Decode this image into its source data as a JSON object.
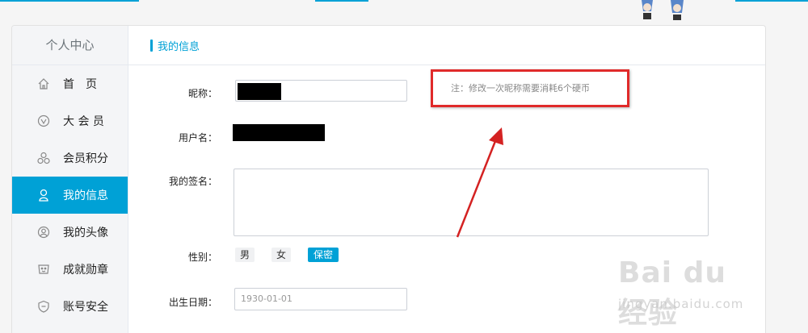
{
  "colors": {
    "accent": "#00a1d6",
    "annotation": "#e02a2a",
    "sidebar_bg": "#f4f5f7"
  },
  "sidebar": {
    "title": "个人中心",
    "items": [
      {
        "label": "首　页",
        "icon": "home-icon",
        "active": false
      },
      {
        "label": "大 会 员",
        "icon": "vip-icon",
        "active": false
      },
      {
        "label": "会员积分",
        "icon": "points-icon",
        "active": false
      },
      {
        "label": "我的信息",
        "icon": "user-icon",
        "active": true
      },
      {
        "label": "我的头像",
        "icon": "avatar-icon",
        "active": false
      },
      {
        "label": "成就勋章",
        "icon": "medal-icon",
        "active": false
      },
      {
        "label": "账号安全",
        "icon": "shield-icon",
        "active": false
      }
    ]
  },
  "content": {
    "title": "我的信息",
    "nickname_label": "昵称：",
    "nickname_hint": "注：修改一次昵称需要消耗6个硬币",
    "username_label": "用户名：",
    "signature_label": "我的签名：",
    "signature_value": "",
    "gender_label": "性别：",
    "gender_options": [
      {
        "label": "男",
        "selected": false
      },
      {
        "label": "女",
        "selected": false
      },
      {
        "label": "保密",
        "selected": true
      }
    ],
    "birthday_label": "出生日期：",
    "birthday_value": "1930-01-01"
  },
  "watermark": {
    "brand": "Bai du 经验",
    "url": "jingyan.baidu.com"
  }
}
